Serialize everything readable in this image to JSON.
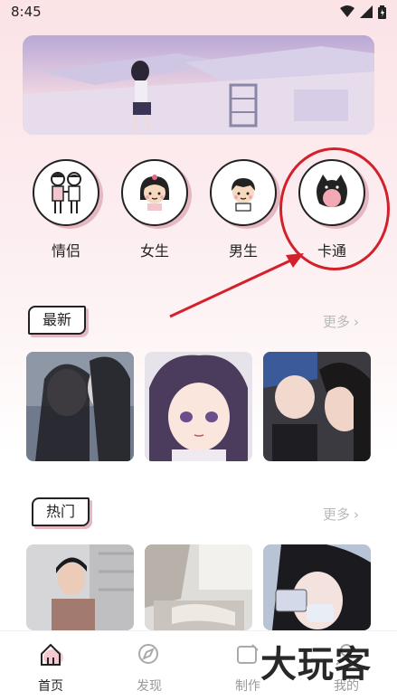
{
  "status_bar": {
    "time": "8:45"
  },
  "categories": [
    {
      "label": "情侣",
      "icon": "couple-icon"
    },
    {
      "label": "女生",
      "icon": "girl-icon"
    },
    {
      "label": "男生",
      "icon": "boy-icon"
    },
    {
      "label": "卡通",
      "icon": "cat-cartoon-icon"
    }
  ],
  "sections": {
    "latest": {
      "title": "最新",
      "more": "更多"
    },
    "hot": {
      "title": "热门",
      "more": "更多"
    }
  },
  "bottom_nav": [
    {
      "label": "首页",
      "icon": "home-icon",
      "active": true
    },
    {
      "label": "发现",
      "icon": "discover-icon",
      "active": false
    },
    {
      "label": "制作",
      "icon": "create-icon",
      "active": false
    },
    {
      "label": "我的",
      "icon": "profile-icon",
      "active": false
    }
  ],
  "watermark": "大玩客",
  "colors": {
    "accent_pink": "#e5b7c1",
    "annotation_red": "#d4202a",
    "muted_gray": "#b9b9b9"
  }
}
